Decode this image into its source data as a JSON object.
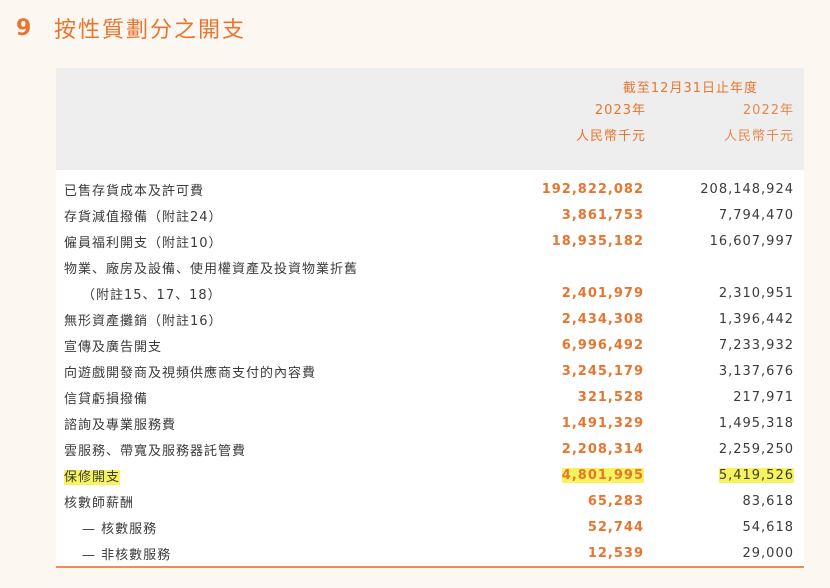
{
  "heading": {
    "number": "9",
    "title": "按性質劃分之開支"
  },
  "header": {
    "period": "截至12月31日止年度",
    "col1": {
      "year": "2023年",
      "unit": "人民幣千元"
    },
    "col2": {
      "year": "2022年",
      "unit": "人民幣千元"
    }
  },
  "rows": [
    {
      "label": "已售存貨成本及許可費",
      "v2023": "192,822,082",
      "v2022": "208,148,924"
    },
    {
      "label": "存貨減值撥備（附註24）",
      "v2023": "3,861,753",
      "v2022": "7,794,470"
    },
    {
      "label": "僱員福利開支（附註10）",
      "v2023": "18,935,182",
      "v2022": "16,607,997"
    },
    {
      "label": "物業、廠房及設備、使用權資產及投資物業折舊",
      "v2023": "",
      "v2022": ""
    },
    {
      "label": "（附註15、17、18）",
      "v2023": "2,401,979",
      "v2022": "2,310,951"
    },
    {
      "label": "無形資產攤銷（附註16）",
      "v2023": "2,434,308",
      "v2022": "1,396,442"
    },
    {
      "label": "宣傳及廣告開支",
      "v2023": "6,996,492",
      "v2022": "7,233,932"
    },
    {
      "label": "向遊戲開發商及視頻供應商支付的內容費",
      "v2023": "3,245,179",
      "v2022": "3,137,676"
    },
    {
      "label": "信貸虧損撥備",
      "v2023": "321,528",
      "v2022": "217,971"
    },
    {
      "label": "諮詢及專業服務費",
      "v2023": "1,491,329",
      "v2022": "1,495,318"
    },
    {
      "label": "雲服務、帶寬及服務器託管費",
      "v2023": "2,208,314",
      "v2022": "2,259,250"
    },
    {
      "label": "保修開支",
      "v2023": "4,801,995",
      "v2022": "5,419,526"
    },
    {
      "label": "核數師薪酬",
      "v2023": "65,283",
      "v2022": "83,618"
    },
    {
      "label": "— 核數服務",
      "v2023": "52,744",
      "v2022": "54,618"
    },
    {
      "label": "— 非核數服務",
      "v2023": "12,539",
      "v2022": "29,000"
    }
  ],
  "colors": {
    "accent": "#e8752f",
    "highlight": "#f6f45c",
    "header_bg": "#eeeeee",
    "page_bg": "#fdf7f1"
  }
}
